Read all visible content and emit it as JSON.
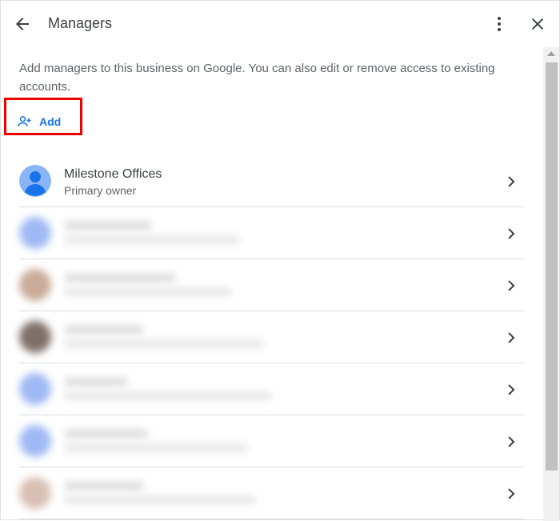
{
  "header": {
    "title": "Managers",
    "icons": {
      "back": "arrow-back-icon",
      "more": "more-vert-icon",
      "close": "close-icon"
    }
  },
  "description": "Add managers to this business on Google. You can also edit or remove access to existing accounts.",
  "add_button": {
    "label": "Add",
    "icon": "person-add-icon",
    "highlight_color": "#ee0000"
  },
  "managers": [
    {
      "name": "Milestone Offices",
      "role": "Primary owner",
      "avatar_color": "#8ab4f8",
      "blurred": false
    },
    {
      "name": "",
      "role": "",
      "avatar_color": "#9fb9f5",
      "blurred": true
    },
    {
      "name": "",
      "role": "",
      "avatar_color": "#c9ab97",
      "blurred": true
    },
    {
      "name": "",
      "role": "",
      "avatar_color": "#7d7067",
      "blurred": true
    },
    {
      "name": "",
      "role": "",
      "avatar_color": "#9fb9f5",
      "blurred": true
    },
    {
      "name": "",
      "role": "",
      "avatar_color": "#9fb9f5",
      "blurred": true
    },
    {
      "name": "",
      "role": "",
      "avatar_color": "#d8c0b4",
      "blurred": true
    }
  ],
  "colors": {
    "accent": "#1a73e8",
    "text": "#3c4043",
    "secondary": "#5f6368",
    "divider": "#dadce0"
  }
}
